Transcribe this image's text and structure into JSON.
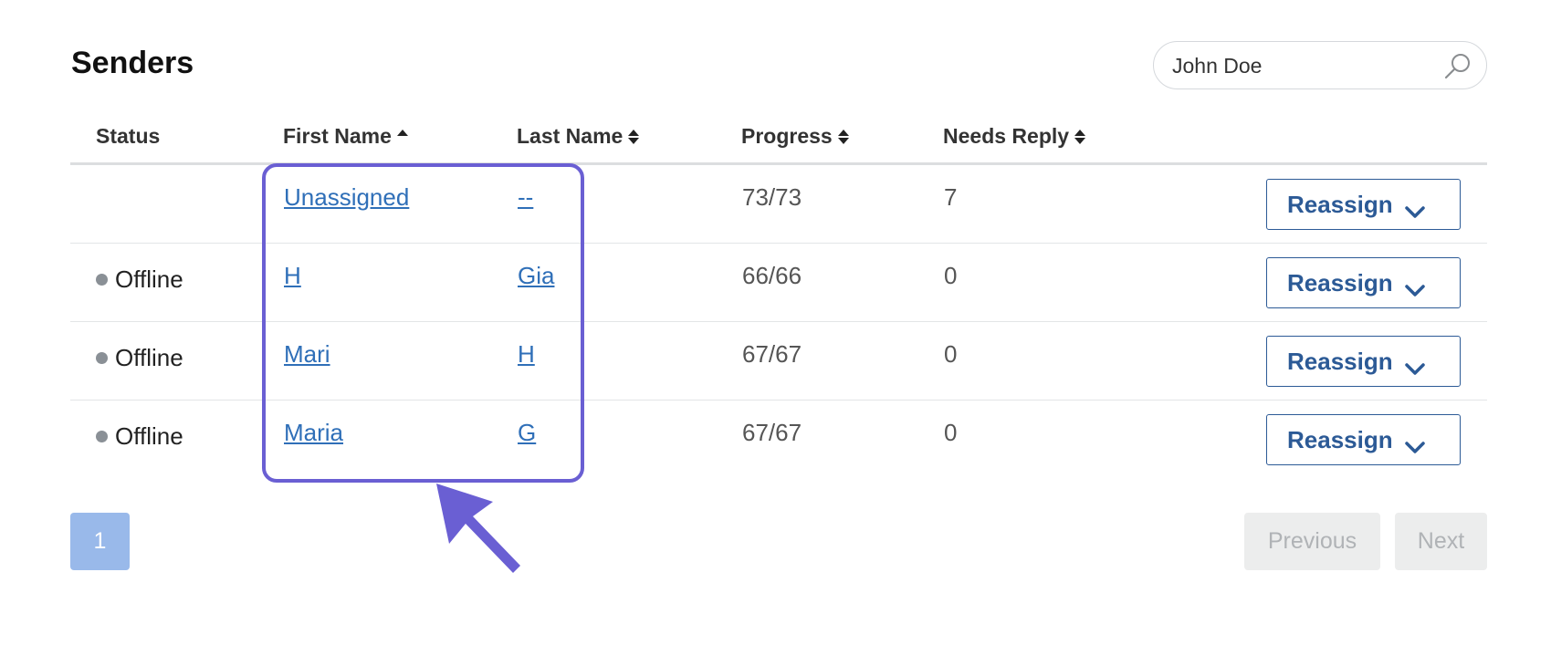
{
  "page": {
    "title": "Senders"
  },
  "search": {
    "value": "John Doe"
  },
  "table": {
    "headers": {
      "status": "Status",
      "first_name": "First Name",
      "last_name": "Last Name",
      "progress": "Progress",
      "needs_reply": "Needs Reply"
    },
    "rows": [
      {
        "status": "",
        "first_name": "Unassigned",
        "last_name": "--",
        "progress": "73/73",
        "needs_reply": "7",
        "action": "Reassign"
      },
      {
        "status": "Offline",
        "first_name": "H",
        "last_name": "Gia",
        "progress": "66/66",
        "needs_reply": "0",
        "action": "Reassign"
      },
      {
        "status": "Offline",
        "first_name": "Mari",
        "last_name": "H",
        "progress": "67/67",
        "needs_reply": "0",
        "action": "Reassign"
      },
      {
        "status": "Offline",
        "first_name": "Maria",
        "last_name": "G",
        "progress": "67/67",
        "needs_reply": "0",
        "action": "Reassign"
      }
    ]
  },
  "pagination": {
    "current": "1",
    "previous": "Previous",
    "next": "Next"
  },
  "colors": {
    "accent": "#2c5a96",
    "link": "#2f6fb8",
    "highlight": "#6a5fd3",
    "page_active": "#99b9ea"
  }
}
